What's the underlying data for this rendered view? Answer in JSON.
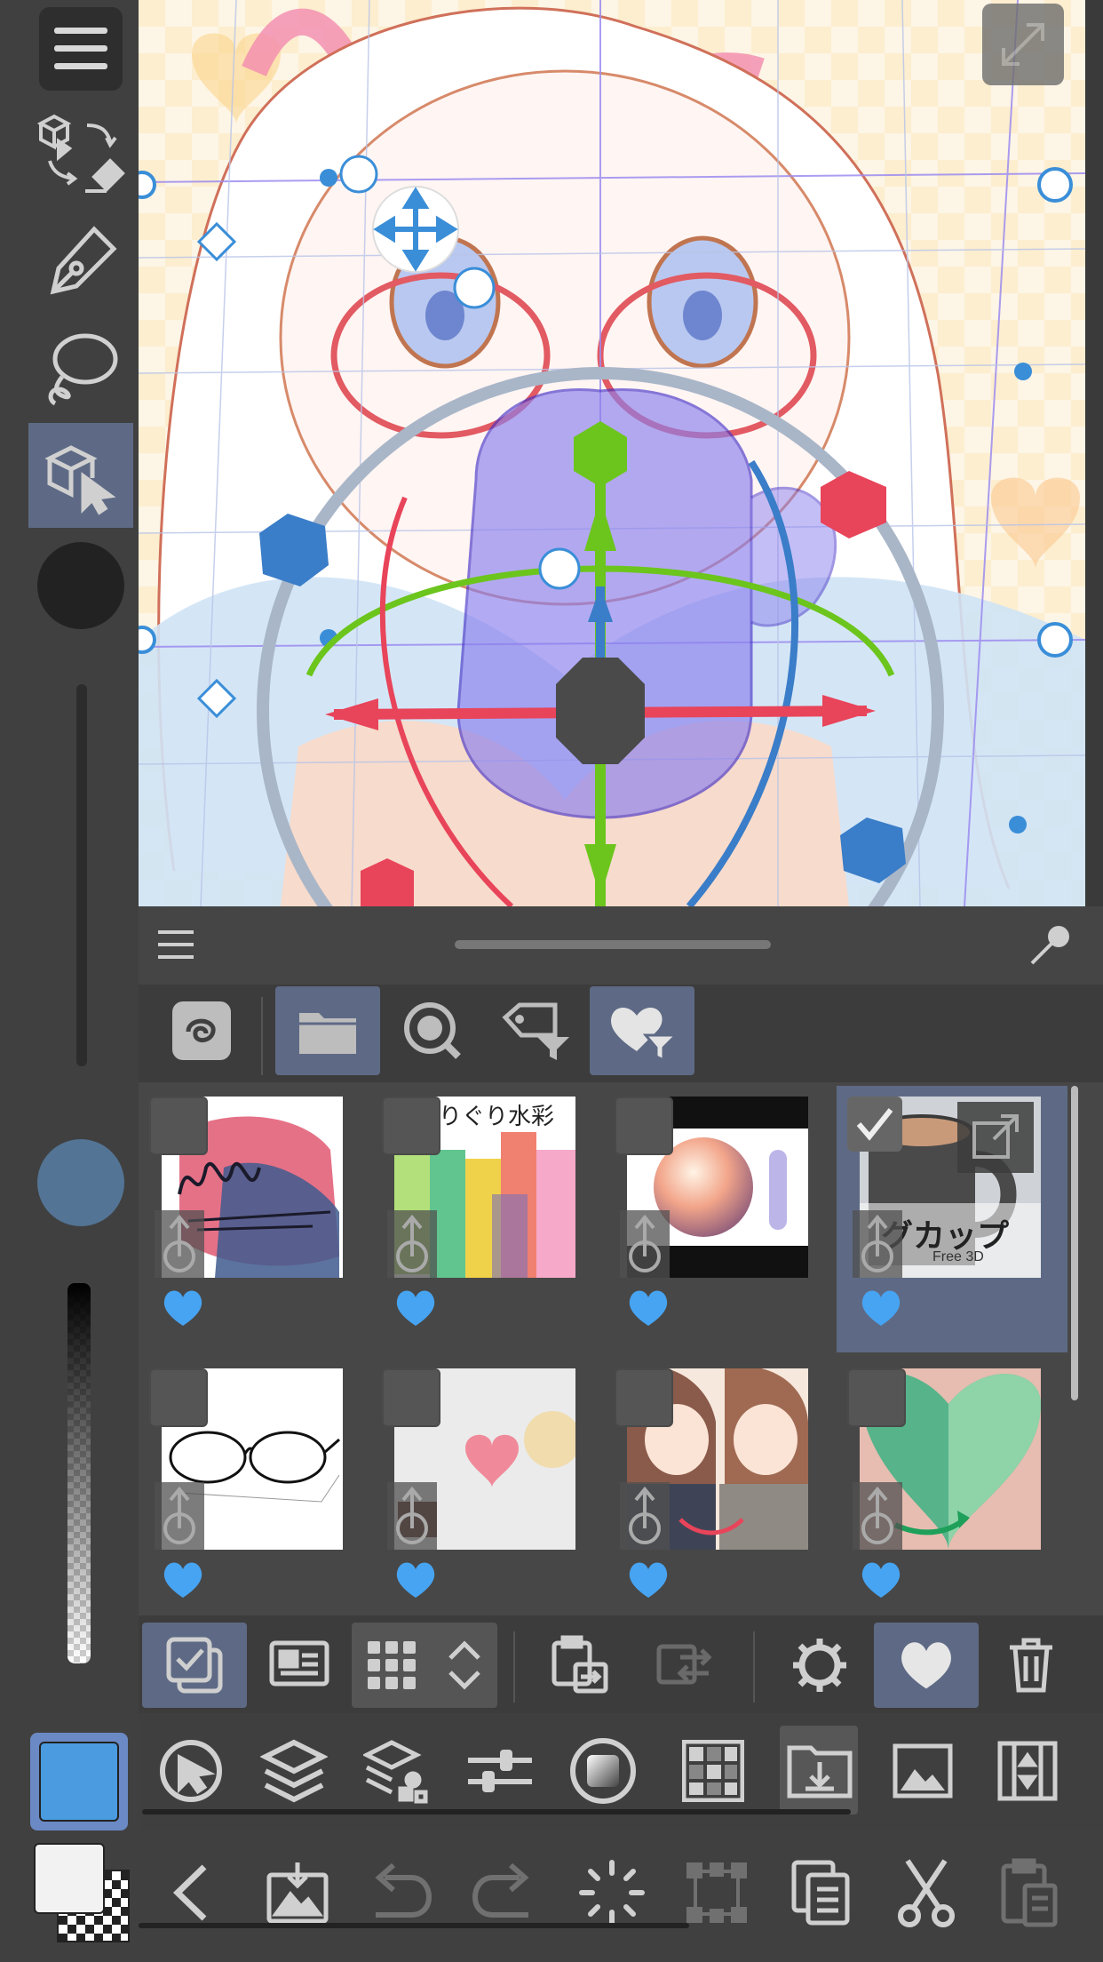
{
  "app": {
    "left_toolbar": {
      "items": [
        {
          "icon": "menu-icon"
        },
        {
          "icon": "transform-object-icon"
        },
        {
          "icon": "pen-icon"
        },
        {
          "icon": "lasso-icon"
        },
        {
          "icon": "object-select-icon",
          "active": true
        },
        {
          "icon": "brush-size-dot-icon"
        },
        {
          "icon": "color-dot-icon"
        }
      ],
      "main_color": "#4a9bdf",
      "sub_color": "#f2f2f2"
    },
    "canvas": {
      "expand_icon": "expand-icon"
    },
    "material_panel": {
      "header": {
        "menu_icon": "menu-icon",
        "pin_icon": "pin-icon"
      },
      "tabs": [
        {
          "icon": "cloud-icon",
          "active": false
        },
        {
          "icon": "folder-icon",
          "active": true
        },
        {
          "icon": "search-icon",
          "active": false
        },
        {
          "icon": "tag-filter-icon",
          "active": false
        },
        {
          "icon": "favorite-filter-icon",
          "active": true
        }
      ],
      "items": [
        {
          "thumb": "paint-strokes",
          "checked": false,
          "favorite": true
        },
        {
          "thumb": "watercolor",
          "text": "りぐり水彩",
          "checked": false,
          "favorite": true
        },
        {
          "thumb": "sphere",
          "checked": false,
          "favorite": true
        },
        {
          "thumb": "mug",
          "text": "グカップ",
          "subtext": "Free 3D",
          "checked": true,
          "favorite": true,
          "selected": true
        },
        {
          "thumb": "glasses",
          "checked": false,
          "favorite": true
        },
        {
          "thumb": "sweets",
          "checked": false,
          "favorite": true
        },
        {
          "thumb": "girl",
          "checked": false,
          "favorite": true
        },
        {
          "thumb": "gem-heart",
          "checked": false,
          "favorite": true
        }
      ]
    },
    "toolbar_material": [
      {
        "icon": "multi-select-icon",
        "active": true
      },
      {
        "icon": "detail-view-icon"
      },
      {
        "icon": "grid-view-icon"
      },
      {
        "icon": "paste-to-canvas-icon"
      },
      {
        "icon": "replace-icon",
        "disabled": true
      },
      {
        "icon": "settings-icon"
      },
      {
        "icon": "favorite-icon",
        "active": true
      },
      {
        "icon": "trash-icon"
      }
    ],
    "toolbar_palettes": [
      {
        "icon": "tool-property-icon"
      },
      {
        "icon": "layers-icon"
      },
      {
        "icon": "layer-property-icon"
      },
      {
        "icon": "adjust-icon"
      },
      {
        "icon": "gradient-icon"
      },
      {
        "icon": "navigator-icon"
      },
      {
        "icon": "material-icon",
        "active": true
      },
      {
        "icon": "image-icon"
      },
      {
        "icon": "timeline-icon"
      }
    ],
    "toolbar_commands": [
      {
        "icon": "back-icon"
      },
      {
        "icon": "import-icon"
      },
      {
        "icon": "undo-icon",
        "disabled": true
      },
      {
        "icon": "redo-icon",
        "disabled": true
      },
      {
        "icon": "loading-icon"
      },
      {
        "icon": "transform-icon",
        "disabled": true
      },
      {
        "icon": "copy-icon"
      },
      {
        "icon": "cut-icon"
      },
      {
        "icon": "paste-icon",
        "disabled": true
      }
    ]
  }
}
